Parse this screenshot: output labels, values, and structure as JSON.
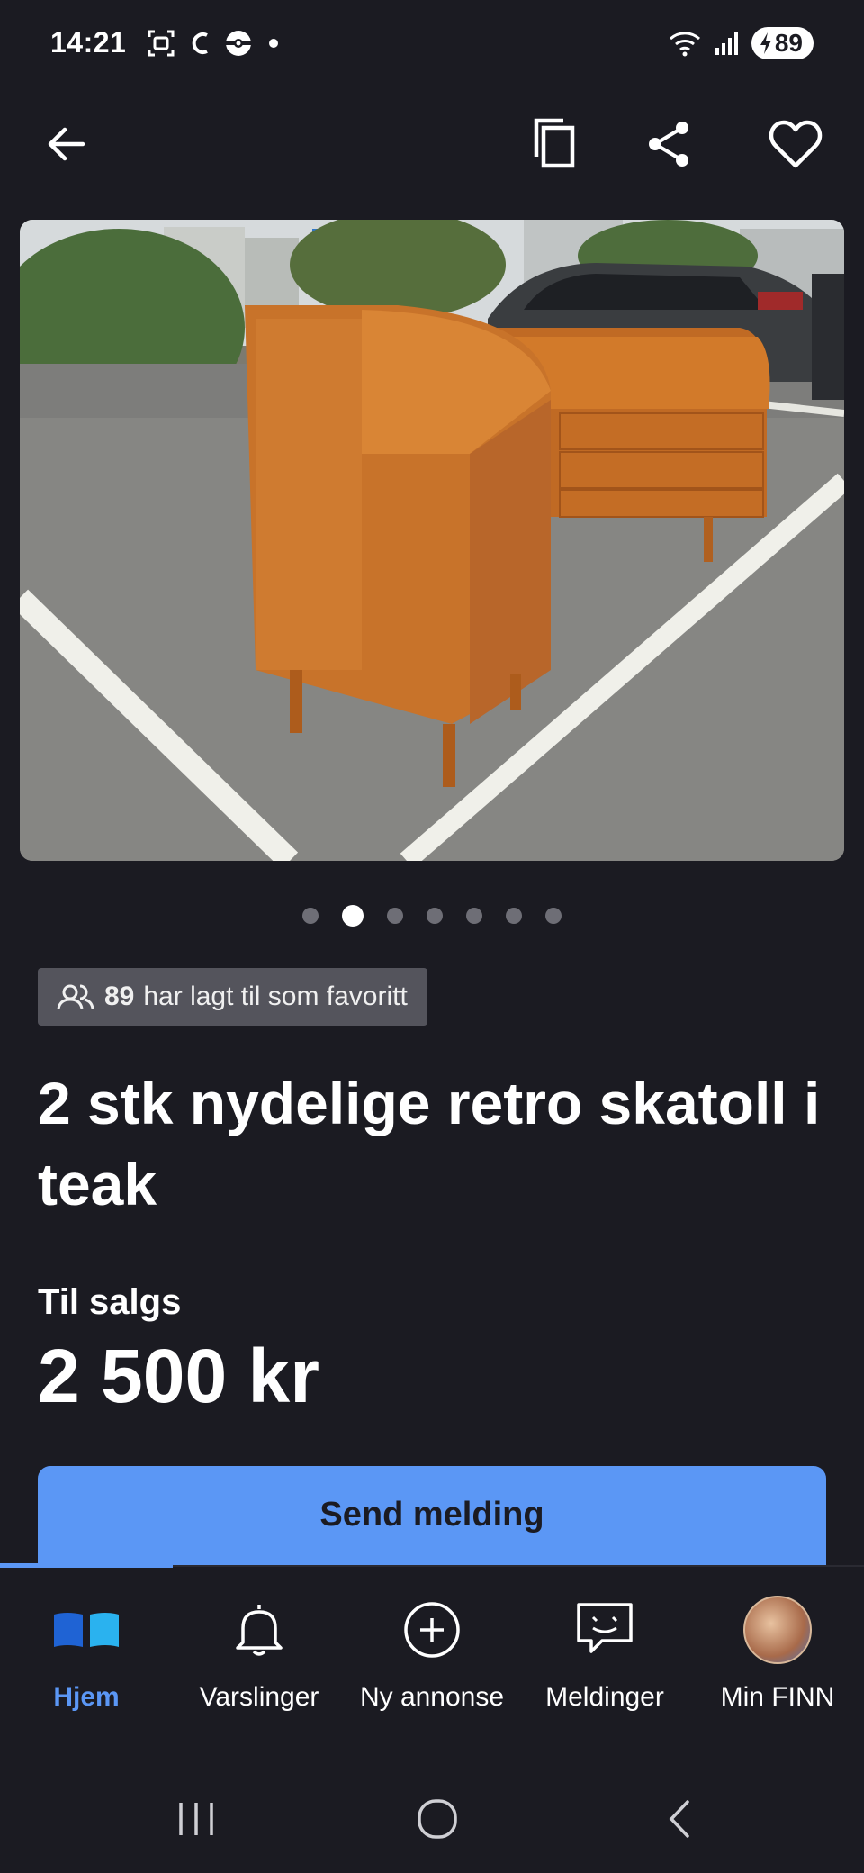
{
  "status_bar": {
    "time": "14:21",
    "battery": "89"
  },
  "listing": {
    "favorites_count": "89",
    "favorites_text": "har lagt til som favoritt",
    "title": "2 stk nydelige retro skatoll i teak",
    "sale_type": "Til salgs",
    "price": "2 500 kr",
    "send_button": "Send melding",
    "photo_count": 7,
    "photo_index": 2
  },
  "bottom_nav": {
    "items": [
      {
        "label": "Hjem",
        "icon": "home-icon",
        "active": true
      },
      {
        "label": "Varslinger",
        "icon": "bell-icon",
        "active": false
      },
      {
        "label": "Ny annonse",
        "icon": "plus-circle-icon",
        "active": false
      },
      {
        "label": "Meldinger",
        "icon": "chat-icon",
        "active": false
      },
      {
        "label": "Min FINN",
        "icon": "avatar",
        "active": false
      }
    ]
  },
  "colors": {
    "background": "#1b1b22",
    "accent": "#5b97f5",
    "badge_bg": "#54545c"
  }
}
